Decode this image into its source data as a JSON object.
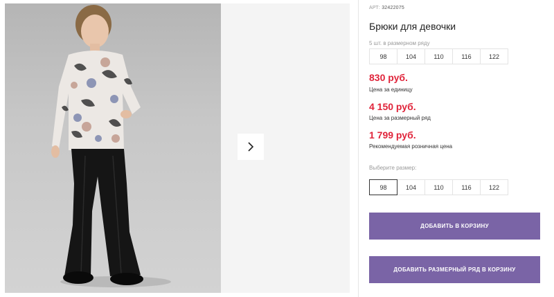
{
  "product": {
    "sku_label": "АРТ:",
    "sku": "32422075",
    "title": "Брюки для девочки"
  },
  "size_row": {
    "label": "5 шт. в размерном ряду",
    "sizes": [
      "98",
      "104",
      "110",
      "116",
      "122"
    ]
  },
  "prices": [
    {
      "value": "830 руб.",
      "note": "Цена за единицу"
    },
    {
      "value": "4 150 руб.",
      "note": "Цена за размерный ряд"
    },
    {
      "value": "1 799 руб.",
      "note": "Рекомендуемая розничная цена"
    }
  ],
  "size_picker": {
    "label": "Выберите размер:",
    "sizes": [
      "98",
      "104",
      "110",
      "116",
      "122"
    ],
    "selected": "98"
  },
  "buttons": {
    "add_to_cart": "ДОБАВИТЬ В КОРЗИНУ",
    "add_size_row": "ДОБАВИТЬ РАЗМЕРНЫЙ РЯД В КОРЗИНУ"
  },
  "icons": {
    "next": "chevron-right-icon"
  },
  "colors": {
    "price": "#e0243a",
    "button": "#7a64a6"
  }
}
